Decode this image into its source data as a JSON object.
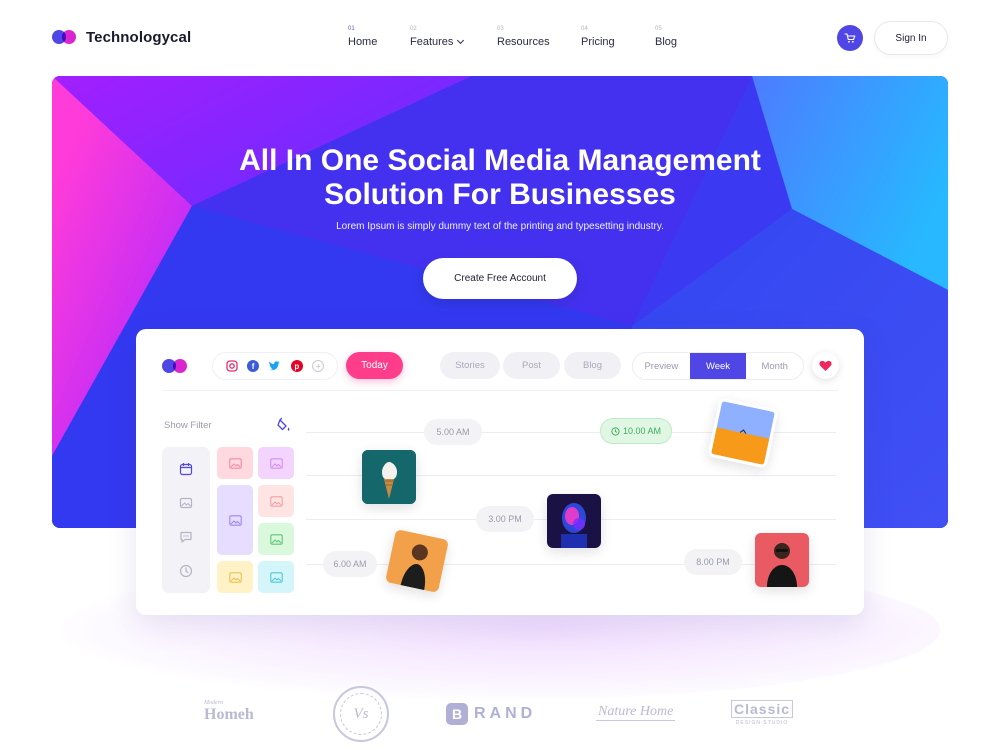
{
  "brand": {
    "name": "Technologycal",
    "colors": {
      "primary": "#4f46e5",
      "accent": "#d926d0",
      "pink": "#ff3d8a"
    }
  },
  "nav": {
    "items": [
      {
        "num": "01",
        "label": "Home",
        "active": true
      },
      {
        "num": "02",
        "label": "Features",
        "dropdown": true
      },
      {
        "num": "03",
        "label": "Resources"
      },
      {
        "num": "04",
        "label": "Pricing"
      },
      {
        "num": "05",
        "label": "Blog"
      }
    ],
    "cart_icon": "cart-icon",
    "signin_label": "Sign In"
  },
  "hero": {
    "title_line1": "All In One Social Media Management",
    "title_line2": "Solution For Businesses",
    "subtitle": "Lorem Ipsum is simply dummy text of the printing and typesetting industry.",
    "cta_label": "Create Free Account"
  },
  "dashboard": {
    "social_icons": [
      "instagram-icon",
      "facebook-icon",
      "twitter-icon",
      "pinterest-icon",
      "add-icon"
    ],
    "today_label": "Today",
    "content_tabs": [
      "Stories",
      "Post",
      "Blog"
    ],
    "view_tabs": [
      {
        "label": "Preview"
      },
      {
        "label": "Week",
        "active": true
      },
      {
        "label": "Month"
      }
    ],
    "favorite_icon": "heart-icon",
    "show_filter_label": "Show Filter",
    "filter_icon": "paint-bucket-icon",
    "tools": [
      "calendar-icon",
      "image-gallery-icon",
      "comment-icon",
      "clock-icon"
    ],
    "times": {
      "t1": "5.00 AM",
      "t2": "10.00 AM",
      "t3": "3.00 PM",
      "t4": "6.00 AM",
      "t5": "8.00 PM"
    }
  },
  "brands": {
    "b1_small": "Modern",
    "b1": "Homeh",
    "b2": "Vs",
    "b3_letter": "B",
    "b3": "RAND",
    "b4": "Nature Home",
    "b5": "Classic",
    "b5_small": "DESIGN STUDIO"
  }
}
